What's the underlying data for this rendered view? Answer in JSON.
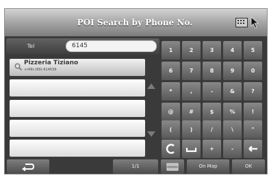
{
  "header": {
    "title": "POI Search by Phone No."
  },
  "tel": {
    "label": "Tel",
    "value": "6145"
  },
  "results": [
    {
      "name": "Pizzeria Tiziano",
      "phone": "+(49)-(69)-614539"
    }
  ],
  "pagination": "1/1",
  "keypad": {
    "rows": [
      [
        "1",
        "2",
        "3",
        "4",
        "5"
      ],
      [
        "6",
        "7",
        "8",
        "9",
        "0"
      ],
      [
        "*",
        ",",
        "-",
        "&",
        "?"
      ],
      [
        "@",
        "#",
        "$",
        "%",
        "!"
      ],
      [
        "(",
        ")",
        "/",
        "\\",
        "\""
      ]
    ],
    "bottom_keys": [
      "+",
      "-"
    ]
  },
  "buttons": {
    "on_map": "On Map",
    "ok": "OK"
  },
  "colors": {
    "title_bar": "#a9a9a9",
    "background": "#3a3a3a",
    "key": "#6e6e6e",
    "list_item": "#efefef"
  },
  "icons": [
    "keyboard-icon",
    "cursor-icon",
    "search-icon",
    "scroll-up-icon",
    "scroll-down-icon",
    "backspace-icon",
    "space-icon",
    "delete-icon",
    "back-icon",
    "map-icon"
  ]
}
